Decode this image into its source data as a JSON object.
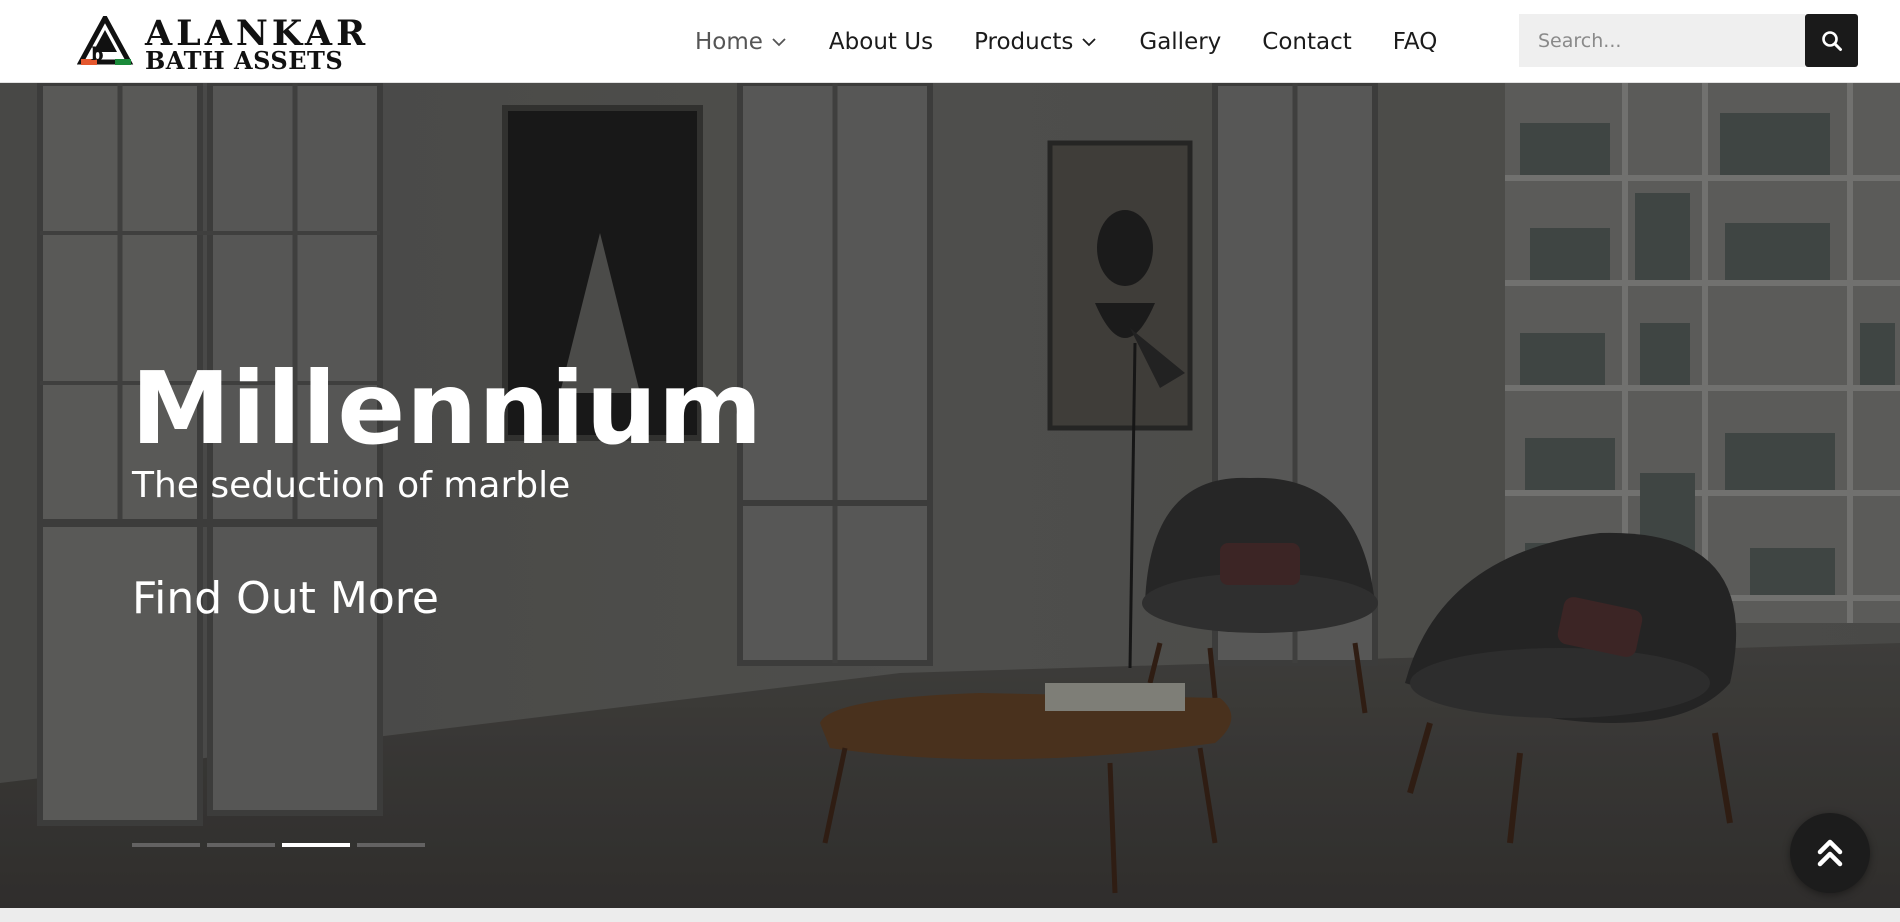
{
  "brand": {
    "line1": "ALANKAR",
    "line2": "BATH ASSETS",
    "logo_icon": "triangle-logo-icon"
  },
  "nav": {
    "items": [
      {
        "label": "Home",
        "has_dropdown": true,
        "active": true
      },
      {
        "label": "About Us",
        "has_dropdown": false
      },
      {
        "label": "Products",
        "has_dropdown": true
      },
      {
        "label": "Gallery",
        "has_dropdown": false
      },
      {
        "label": "Contact",
        "has_dropdown": false
      },
      {
        "label": "FAQ",
        "has_dropdown": false
      }
    ]
  },
  "search": {
    "placeholder": "Search...",
    "value": "",
    "button_icon": "search-icon"
  },
  "hero": {
    "title": "Millennium",
    "subtitle": "The seduction of marble",
    "cta": "Find Out More",
    "slides_count": 4,
    "active_slide": 3
  },
  "back_to_top": {
    "icon": "double-chevron-up-icon"
  },
  "colors": {
    "header_bg": "#ffffff",
    "nav_text": "#1b1b1b",
    "nav_active": "#555555",
    "search_bg": "#efefef",
    "search_button": "#1a1a1a",
    "hero_overlay": "#4a4a48",
    "logo_orange": "#e4572e",
    "logo_green": "#1a8a3a"
  }
}
